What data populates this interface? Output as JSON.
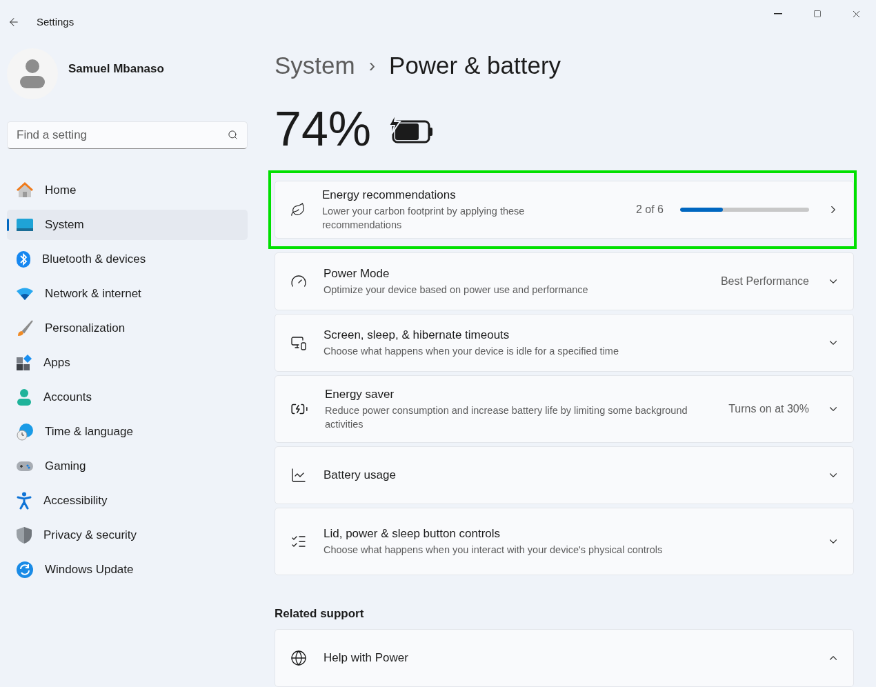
{
  "window": {
    "title": "Settings"
  },
  "account": {
    "name": "Samuel Mbanaso"
  },
  "search": {
    "placeholder": "Find a setting"
  },
  "sidebar": {
    "items": [
      {
        "label": "Home",
        "selected": false
      },
      {
        "label": "System",
        "selected": true
      },
      {
        "label": "Bluetooth & devices",
        "selected": false
      },
      {
        "label": "Network & internet",
        "selected": false
      },
      {
        "label": "Personalization",
        "selected": false
      },
      {
        "label": "Apps",
        "selected": false
      },
      {
        "label": "Accounts",
        "selected": false
      },
      {
        "label": "Time & language",
        "selected": false
      },
      {
        "label": "Gaming",
        "selected": false
      },
      {
        "label": "Accessibility",
        "selected": false
      },
      {
        "label": "Privacy & security",
        "selected": false
      },
      {
        "label": "Windows Update",
        "selected": false
      }
    ]
  },
  "breadcrumb": {
    "parent": "System",
    "separator": "›",
    "current": "Power & battery"
  },
  "battery": {
    "percent": "74%",
    "charging": true
  },
  "cards": [
    {
      "kind": "link",
      "title": "Energy recommendations",
      "description": "Lower your carbon footprint by applying these recommendations",
      "value": "2 of 6",
      "level": 0.333,
      "highlighted": true
    },
    {
      "kind": "expander",
      "title": "Power Mode",
      "description": "Optimize your device based on power use and performance",
      "value": "Best Performance",
      "expanded": false,
      "highlighted": false
    },
    {
      "kind": "expander",
      "title": "Screen, sleep, & hibernate timeouts",
      "description": "Choose what happens when your device is idle for a specified time",
      "expanded": false,
      "highlighted": false
    },
    {
      "kind": "expander",
      "title": "Energy saver",
      "description": "Reduce power consumption and increase battery life by limiting some background activities",
      "value": "Turns on at 30%",
      "expanded": false,
      "highlighted": false
    },
    {
      "kind": "expander",
      "title": "Battery usage",
      "expanded": false,
      "highlighted": false
    },
    {
      "kind": "expander",
      "title": "Lid, power & sleep button controls",
      "description": "Choose what happens when you interact with your device's physical controls",
      "expanded": false,
      "highlighted": false
    }
  ],
  "related": {
    "heading": "Related support",
    "items": [
      {
        "kind": "expander",
        "title": "Help with Power",
        "expanded": true,
        "highlighted": false
      }
    ]
  }
}
